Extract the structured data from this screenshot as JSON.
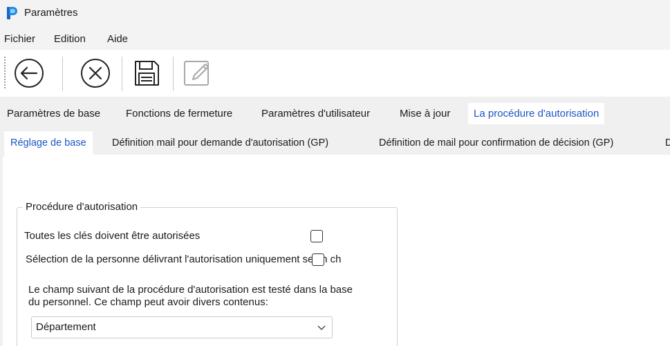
{
  "window": {
    "title": "Paramètres"
  },
  "menu": {
    "items": [
      "Fichier",
      "Edition",
      "Aide"
    ]
  },
  "toolbar": {
    "buttons": [
      "back-icon",
      "cancel-icon",
      "save-icon",
      "edit-icon"
    ]
  },
  "tabs_primary": {
    "items": [
      "Paramètres de base",
      "Fonctions de fermeture",
      "Paramètres d'utilisateur",
      "Mise à jour",
      "La procédure d'autorisation"
    ],
    "active": "La procédure d'autorisation"
  },
  "tabs_secondary": {
    "items": [
      "Réglage de base",
      "Définition mail pour demande d'autorisation (GP)",
      "Définition de mail pour confirmation de décision (GP)",
      "D"
    ],
    "active": "Réglage de base"
  },
  "group": {
    "legend": "Procédure d'autorisation",
    "checkbox1_label": "Toutes les clés doivent être autorisées",
    "checkbox1_checked": false,
    "checkbox2_label": "Sélection de la personne délivrant l'autorisation uniquement selon ch",
    "checkbox2_checked": false,
    "description": "Le champ suivant de la procédure d'autorisation est testé dans la base du personnel. Ce champ peut avoir divers contenus:",
    "select_value": "Département"
  },
  "colors": {
    "accent": "#1a56c4",
    "app_icon": "#1e88e5"
  }
}
